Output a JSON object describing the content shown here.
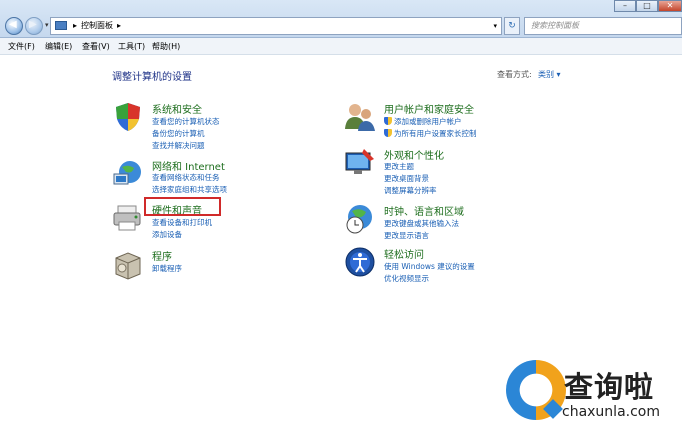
{
  "address": {
    "crumb": "控制面板",
    "search_placeholder": "搜索控制面板"
  },
  "menu": [
    "文件(F)",
    "编辑(E)",
    "查看(V)",
    "工具(T)",
    "帮助(H)"
  ],
  "page_title": "调整计算机的设置",
  "view": {
    "label": "查看方式:",
    "value": "类别 ▾"
  },
  "categories_left": [
    {
      "title": "系统和安全",
      "links": [
        "查看您的计算机状态",
        "备份您的计算机",
        "查找并解决问题"
      ]
    },
    {
      "title": "网络和 Internet",
      "links": [
        "查看网络状态和任务",
        "选择家庭组和共享选项"
      ]
    },
    {
      "title": "硬件和声音",
      "links": [
        "查看设备和打印机",
        "添加设备"
      ]
    },
    {
      "title": "程序",
      "links": [
        "卸载程序"
      ]
    }
  ],
  "categories_right": [
    {
      "title": "用户帐户和家庭安全",
      "links": [
        "添加或删除用户帐户",
        "为所有用户设置家长控制"
      ]
    },
    {
      "title": "外观和个性化",
      "links": [
        "更改主题",
        "更改桌面背景",
        "调整屏幕分辨率"
      ]
    },
    {
      "title": "时钟、语言和区域",
      "links": [
        "更改键盘或其他输入法",
        "更改显示语言"
      ]
    },
    {
      "title": "轻松访问",
      "links": [
        "使用 Windows 建议的设置",
        "优化视频显示"
      ]
    }
  ],
  "watermark": {
    "name": "查询啦",
    "url": "chaxunla.com"
  }
}
